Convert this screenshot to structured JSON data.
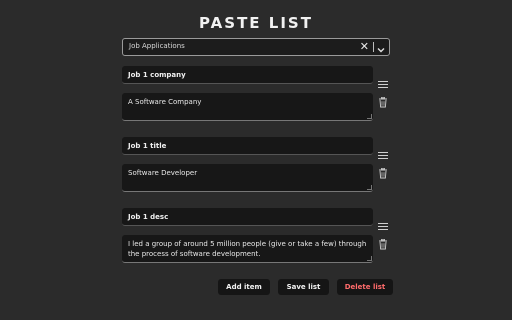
{
  "page": {
    "title": "PASTE LIST"
  },
  "list_select": {
    "value": "Job Applications",
    "clear_glyph": "✕",
    "chevron_icon": "chevron-down-icon"
  },
  "items": [
    {
      "title": "Job 1 company",
      "content": "A Software Company"
    },
    {
      "title": "Job 1 title",
      "content": "Software Developer"
    },
    {
      "title": "Job 1 desc",
      "content": "I led a group of around 5 million people (give or take a few) through the process of software development."
    }
  ],
  "icons": {
    "drag": "drag-handle-icon",
    "delete": "trash-icon"
  },
  "actions": {
    "add_item": "Add item",
    "save_list": "Save list",
    "delete_list": "Delete list"
  },
  "colors": {
    "background": "#2b2b2b",
    "field": "#171717",
    "danger": "#ff6b6b"
  }
}
